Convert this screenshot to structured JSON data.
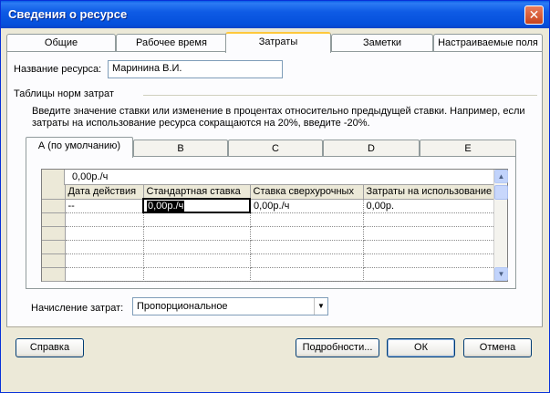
{
  "window": {
    "title": "Сведения о ресурсе",
    "close_glyph": "✕"
  },
  "tabs": [
    {
      "label": "Общие"
    },
    {
      "label": "Рабочее время"
    },
    {
      "label": "Затраты"
    },
    {
      "label": "Заметки"
    },
    {
      "label": "Настраиваемые поля"
    }
  ],
  "active_tab": "Затраты",
  "resource": {
    "label": "Название ресурса:",
    "value": "Маринина В.И."
  },
  "cost_tables": {
    "label": "Таблицы норм затрат",
    "instructions": "Введите значение ставки или изменение в процентах относительно предыдущей ставки. Например, если затраты на использование ресурса сокращаются на 20%, введите -20%.",
    "subtabs": [
      "А (по умолчанию)",
      "B",
      "C",
      "D",
      "E"
    ],
    "active_subtab": "А (по умолчанию)",
    "edit_value": "0,00р./ч",
    "columns": [
      "Дата действия",
      "Стандартная ставка",
      "Ставка сверхурочных",
      "Затраты на использование"
    ],
    "rows": [
      [
        "--",
        "0,00р./ч",
        "0,00р./ч",
        "0,00р."
      ],
      [
        "",
        "",
        "",
        ""
      ],
      [
        "",
        "",
        "",
        ""
      ],
      [
        "",
        "",
        "",
        ""
      ],
      [
        "",
        "",
        "",
        ""
      ],
      [
        "",
        "",
        "",
        ""
      ]
    ]
  },
  "accrual": {
    "label": "Начисление затрат:",
    "value": "Пропорциональное"
  },
  "buttons": {
    "help": "Справка",
    "details": "Подробности...",
    "ok": "ОК",
    "cancel": "Отмена"
  },
  "icons": {
    "close": "close-icon",
    "dropdown": "chevron-down-icon",
    "scroll_up": "arrow-up-icon",
    "scroll_down": "arrow-down-icon"
  }
}
